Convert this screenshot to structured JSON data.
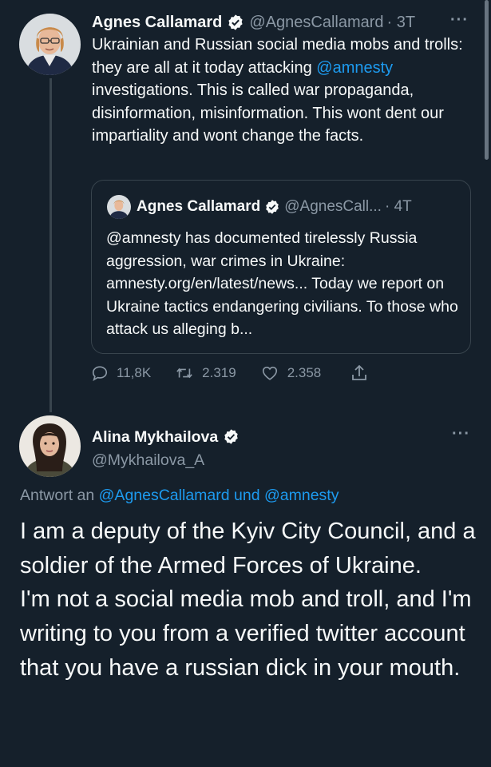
{
  "tweet1": {
    "name": "Agnes Callamard",
    "handle": "@AgnesCallamard",
    "time": "· 3T",
    "more": "···",
    "text_part1": "Ukrainian and Russian social media mobs and trolls: they are all at it today attacking ",
    "mention": "@amnesty",
    "text_part2": " investigations. This is called war propaganda, disinformation, misinformation. This wont dent our impartiality and wont change the facts.",
    "quote": {
      "name": "Agnes Callamard",
      "handle": "@AgnesCall...",
      "time": "· 4T",
      "text": "@amnesty has documented tirelessly Russia aggression, war crimes in Ukraine: amnesty.org/en/latest/news... Today we report on Ukraine tactics endangering civilians. To those who attack us alleging b..."
    },
    "actions": {
      "replies": "11,8K",
      "retweets": "2.319",
      "likes": "2.358"
    }
  },
  "tweet2": {
    "name": "Alina Mykhailova",
    "handle": "@Mykhailova_A",
    "more": "···",
    "reply_prefix": "Antwort an ",
    "reply_mention1": "@AgnesCallamard",
    "reply_und": " und ",
    "reply_mention2": "@amnesty",
    "text": "I am a deputy of the Kyiv City Council, and a soldier of the Armed Forces of Ukraine.\nI'm not a social media mob and troll, and I'm writing to you from a verified twitter account that you have a russian dick in your mouth."
  },
  "colors": {
    "background": "#15202b",
    "text": "#f7f9f9",
    "secondary": "#8b98a5",
    "accent": "#1d9bf0",
    "border": "#38444d"
  }
}
